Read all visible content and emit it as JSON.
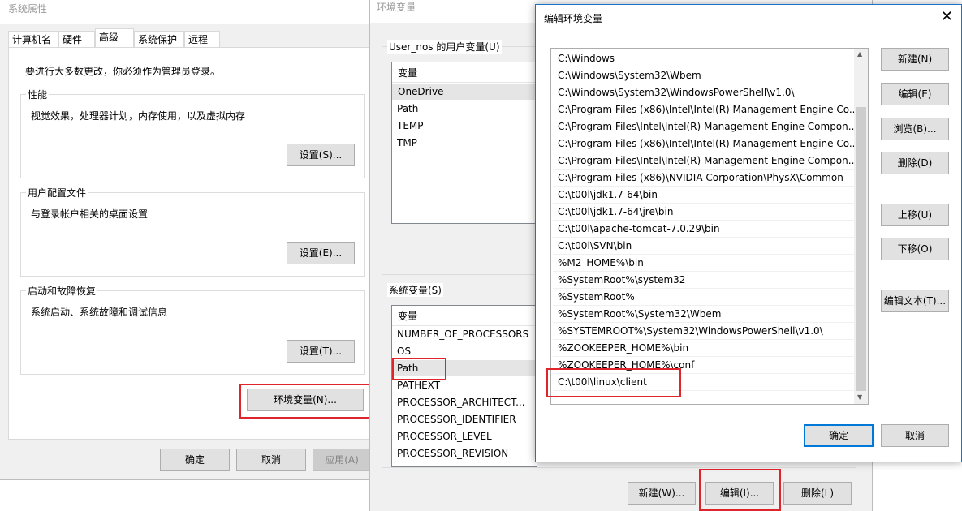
{
  "sys_props": {
    "title": "系统属性",
    "tabs": [
      "计算机名",
      "硬件",
      "高级",
      "系统保护",
      "远程"
    ],
    "admin_note": "要进行大多数更改，你必须作为管理员登录。",
    "performance": {
      "label": "性能",
      "desc": "视觉效果，处理器计划，内存使用，以及虚拟内存",
      "button": "设置(S)..."
    },
    "profile": {
      "label": "用户配置文件",
      "desc": "与登录帐户相关的桌面设置",
      "button": "设置(E)..."
    },
    "startup": {
      "label": "启动和故障恢复",
      "desc": "系统启动、系统故障和调试信息",
      "button": "设置(T)..."
    },
    "env_button": "环境变量(N)...",
    "ok": "确定",
    "cancel": "取消",
    "apply": "应用(A)"
  },
  "env_vars": {
    "title": "环境变量",
    "user_section": "User_nos 的用户变量(U)",
    "column_var": "变量",
    "user_vars": [
      "OneDrive",
      "Path",
      "TEMP",
      "TMP"
    ],
    "sys_section": "系统变量(S)",
    "sys_vars": [
      "NUMBER_OF_PROCESSORS",
      "OS",
      "Path",
      "PATHEXT",
      "PROCESSOR_ARCHITECT...",
      "PROCESSOR_IDENTIFIER",
      "PROCESSOR_LEVEL",
      "PROCESSOR_REVISION"
    ],
    "new": "新建(W)...",
    "edit": "编辑(I)...",
    "delete": "删除(L)"
  },
  "edit_env": {
    "title": "编辑环境变量",
    "paths": [
      "C:\\Windows",
      "C:\\Windows\\System32\\Wbem",
      "C:\\Windows\\System32\\WindowsPowerShell\\v1.0\\",
      "C:\\Program Files (x86)\\Intel\\Intel(R) Management Engine Co...",
      "C:\\Program Files\\Intel\\Intel(R) Management Engine Compon...",
      "C:\\Program Files (x86)\\Intel\\Intel(R) Management Engine Co...",
      "C:\\Program Files\\Intel\\Intel(R) Management Engine Compon...",
      "C:\\Program Files (x86)\\NVIDIA Corporation\\PhysX\\Common",
      "C:\\t00l\\jdk1.7-64\\bin",
      "C:\\t00l\\jdk1.7-64\\jre\\bin",
      "C:\\t00l\\apache-tomcat-7.0.29\\bin",
      "C:\\t00l\\SVN\\bin",
      "%M2_HOME%\\bin",
      "%SystemRoot%\\system32",
      "%SystemRoot%",
      "%SystemRoot%\\System32\\Wbem",
      "%SYSTEMROOT%\\System32\\WindowsPowerShell\\v1.0\\",
      "%ZOOKEEPER_HOME%\\bin",
      "%ZOOKEEPER_HOME%\\conf",
      "C:\\t00l\\linux\\client"
    ],
    "buttons": {
      "new": "新建(N)",
      "edit": "编辑(E)",
      "browse": "浏览(B)...",
      "delete": "删除(D)",
      "up": "上移(U)",
      "down": "下移(O)",
      "edit_text": "编辑文本(T)...",
      "ok": "确定",
      "cancel": "取消"
    }
  },
  "colors": {
    "highlight": "#e0242c",
    "primary_border": "#0078d7"
  }
}
